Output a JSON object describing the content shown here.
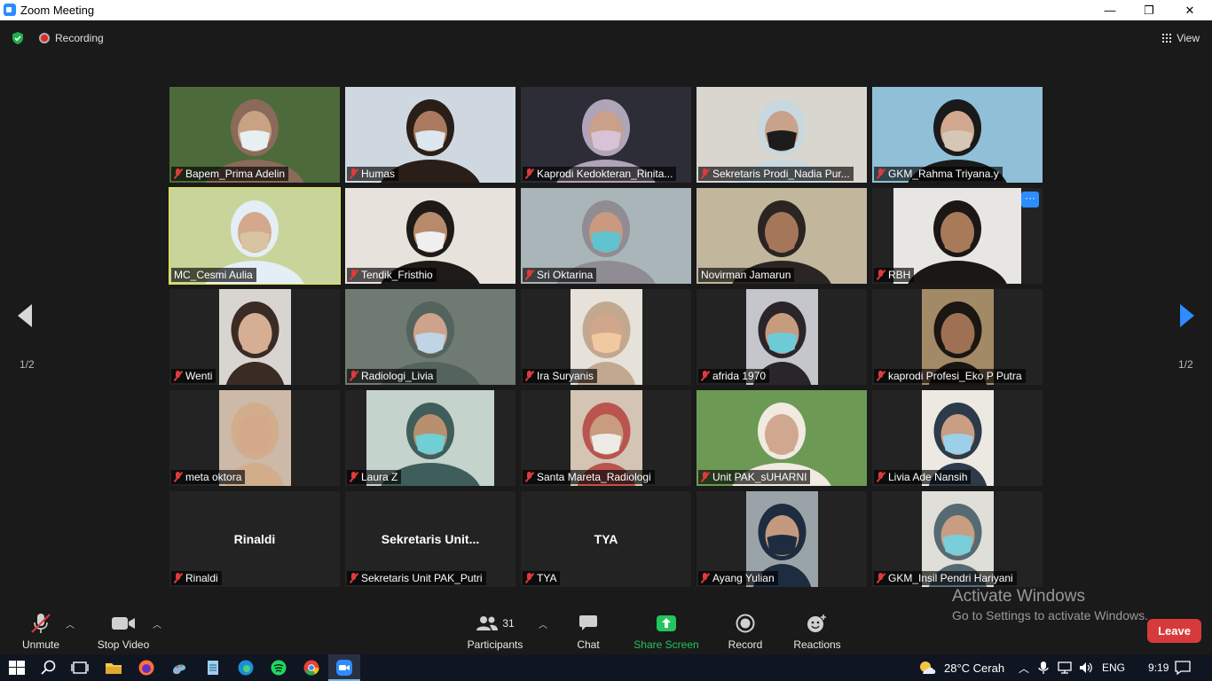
{
  "window": {
    "title": "Zoom Meeting",
    "minimize": "—",
    "maximize": "❐",
    "close": "✕"
  },
  "header": {
    "recording": "Recording",
    "view": "View"
  },
  "pagination": {
    "left": "1/2",
    "right": "1/2"
  },
  "tiles": [
    {
      "name": "Bapem_Prima Adelin",
      "muted": true,
      "bg": "#4d6b3a",
      "skin": "#c9a183",
      "hijab": "#8a6a5a",
      "mask": "#e6f0f3"
    },
    {
      "name": "Humas",
      "muted": true,
      "bg": "#cfd8e0",
      "skin": "#a97a5e",
      "hijab": "#2a1e18",
      "mask": "#dce7ef"
    },
    {
      "name": "Kaprodi Kedokteran_Rinita...",
      "muted": true,
      "bg": "#2c2d36",
      "skin": "#caa08a",
      "hijab": "#b0a4b8",
      "mask": "#d7c2d6"
    },
    {
      "name": "Sekretaris Prodi_Nadia Pur...",
      "muted": true,
      "bg": "#d9d6d0",
      "skin": "#c8a28a",
      "hijab": "#c8d8e0",
      "mask": "#1c1c1c"
    },
    {
      "name": "GKM_Rahma Triyana.y",
      "muted": true,
      "bg": "#8fc0d8",
      "skin": "#d1a88f",
      "hijab": "#1a1a1a",
      "mask": "#d5c7b5"
    },
    {
      "name": "MC_Cesmi Aulia",
      "muted": false,
      "active": true,
      "bg": "#c9d49a",
      "skin": "#d4a88c",
      "hijab": "#e4eef6",
      "mask": "#d8c3a3"
    },
    {
      "name": "Tendik_Fristhio",
      "muted": true,
      "bg": "#e8e2dc",
      "skin": "#b68a6b",
      "hijab": "#1e1a18",
      "mask": "#f0f0f0"
    },
    {
      "name": "Sri Oktarina",
      "muted": true,
      "bg": "#a9b5b8",
      "skin": "#c99a80",
      "hijab": "#8f8c94",
      "mask": "#5fc4cf"
    },
    {
      "name": "Novirman Jamarun",
      "muted": false,
      "bg": "#c2b79d",
      "skin": "#a5765a",
      "hijab": "#2a2522",
      "mask": "#a5765a"
    },
    {
      "name": "RBH",
      "muted": true,
      "more": "···",
      "bg": "#e8e6e2",
      "skin": "#a87a5a",
      "hijab": "#1b1714",
      "mask": "#a87a5a"
    },
    {
      "name": "Wenti",
      "muted": true,
      "bg": "#d8d4d0",
      "skin": "#d6ae93",
      "hijab": "#3a2c24",
      "mask": "#d6ae93"
    },
    {
      "name": "Radiologi_Livia",
      "muted": true,
      "bg": "#6e7a72",
      "skin": "#cda38b",
      "hijab": "#55635e",
      "mask": "#bfd5e6"
    },
    {
      "name": "Ira Suryanis",
      "muted": true,
      "bg": "#e6e2da",
      "skin": "#d0a78c",
      "hijab": "#c2a88e",
      "mask": "#f0c9a0"
    },
    {
      "name": "afrida 1970",
      "muted": true,
      "bg": "#c5c6cc",
      "skin": "#c79b7e",
      "hijab": "#2a2528",
      "mask": "#6fcad8"
    },
    {
      "name": "kaprodi Profesi_Eko P Putra",
      "muted": true,
      "bg": "#a38a66",
      "skin": "#9e7154",
      "hijab": "#1a1612",
      "mask": "#9e7154"
    },
    {
      "name": "meta oktora",
      "muted": true,
      "bg": "#cdb9a8",
      "skin": "#d4a88a",
      "hijab": "#d1ad8c",
      "mask": "#d4a88a"
    },
    {
      "name": "Laura Z",
      "muted": true,
      "bg": "#c4d3cc",
      "skin": "#b9906f",
      "hijab": "#3f5d5a",
      "mask": "#6fcfd3"
    },
    {
      "name": "Santa Mareta_Radiologi",
      "muted": true,
      "bg": "#d3c4b3",
      "skin": "#c99b7f",
      "hijab": "#b9544e",
      "mask": "#ecebe6"
    },
    {
      "name": "Unit PAK_sUHARNI",
      "muted": true,
      "bg": "#6c9a55",
      "skin": "#d0a890",
      "hijab": "#f0eae0",
      "mask": "#d0a890"
    },
    {
      "name": "Livia Ade Nansih",
      "muted": true,
      "bg": "#ece8e2",
      "skin": "#c99e83",
      "hijab": "#2c3a4a",
      "mask": "#9bd0e8"
    },
    {
      "name": "Rinaldi",
      "muted": true,
      "nameplate": "Rinaldi"
    },
    {
      "name": "Sekretaris Unit PAK_Putri",
      "muted": true,
      "nameplate": "Sekretaris  Unit..."
    },
    {
      "name": "TYA",
      "muted": true,
      "nameplate": "TYA"
    },
    {
      "name": "Ayang Yulian",
      "muted": true,
      "bg": "#9aa4a8",
      "skin": "#c49a7e",
      "hijab": "#1e2c40",
      "mask": "#1e2c40"
    },
    {
      "name": "GKM_Insil Pendri Hariyani",
      "muted": true,
      "bg": "#e0ded8",
      "skin": "#c89d82",
      "hijab": "#556a72",
      "mask": "#79cfd9"
    }
  ],
  "toolbar": {
    "unmute": "Unmute",
    "stop_video": "Stop Video",
    "participants": "Participants",
    "participants_count": "31",
    "chat": "Chat",
    "share_screen": "Share Screen",
    "record": "Record",
    "reactions": "Reactions",
    "leave": "Leave"
  },
  "watermark": {
    "line1": "Activate Windows",
    "line2": "Go to Settings to activate Windows."
  },
  "taskbar": {
    "weather": "28°C  Cerah",
    "lang": "ENG",
    "time": "9:19"
  },
  "colors": {
    "accent": "#2d8cff",
    "share_green": "#22c55e",
    "leave_red": "#d73a3a",
    "active_border": "#e8e53c"
  }
}
